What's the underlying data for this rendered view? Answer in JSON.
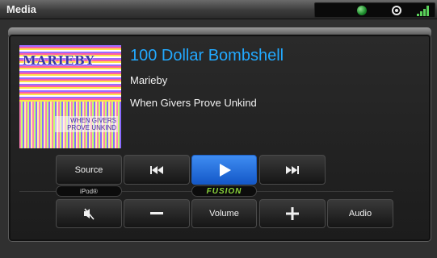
{
  "window": {
    "title": "Media"
  },
  "now_playing": {
    "track": "100 Dollar Bombshell",
    "artist": "Marieby",
    "album": "When Givers Prove Unkind",
    "art_text": "MARIEBY",
    "art_subtext": "WHEN GIVERS PROVE UNKIND"
  },
  "controls": {
    "source": "Source",
    "source_name": "iPod®",
    "brand": "FUSION",
    "volume": "Volume",
    "audio": "Audio",
    "prev_icon": "skip-previous-icon",
    "play_icon": "play-icon",
    "next_icon": "skip-next-icon",
    "mute_icon": "mute-icon",
    "minus_icon": "minus-icon",
    "plus_icon": "plus-icon"
  },
  "colors": {
    "accent": "#22a9ff",
    "active_button": "#2a72e0",
    "brand_green": "#8ad43a"
  }
}
